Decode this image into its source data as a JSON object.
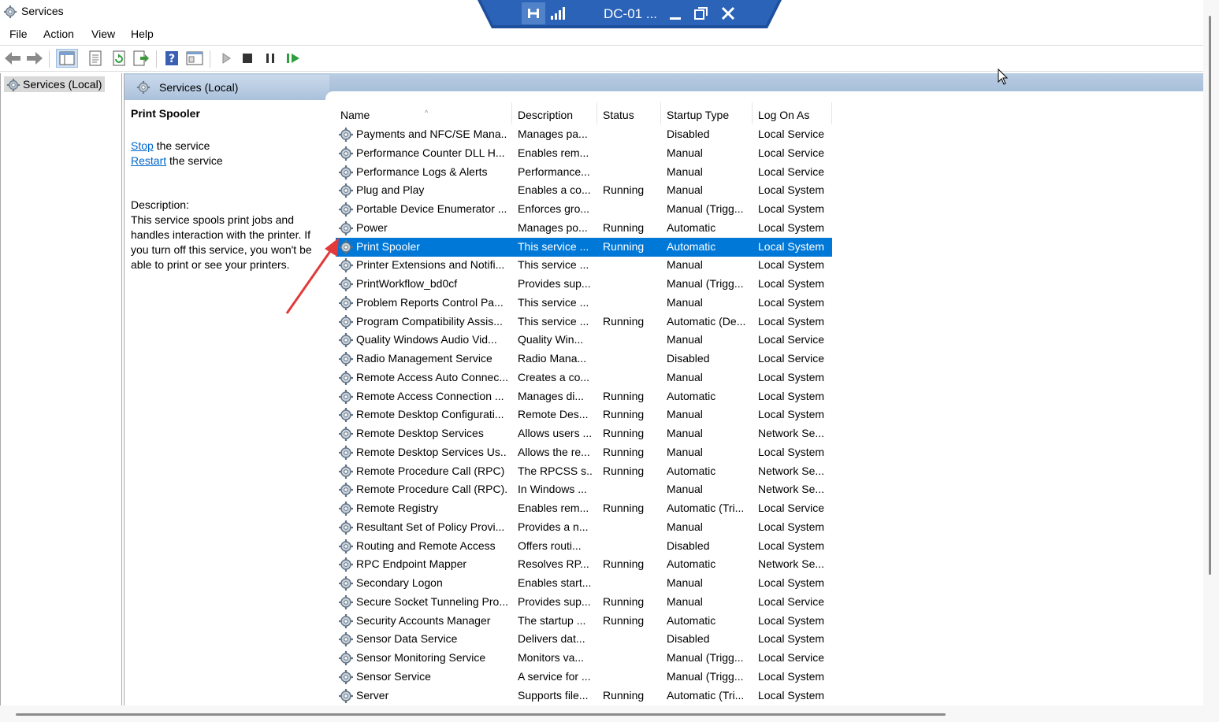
{
  "window": {
    "title": "Services"
  },
  "rdp": {
    "host": "DC-01 ..."
  },
  "menu": [
    "File",
    "Action",
    "View",
    "Help"
  ],
  "toolbar": [
    "back-icon",
    "forward-icon",
    "show-hide-console-tree-icon",
    "properties-icon",
    "refresh-icon",
    "export-list-icon",
    "help-icon",
    "console-view-icon",
    "start-service-icon",
    "stop-service-icon",
    "pause-service-icon",
    "resume-service-icon"
  ],
  "tree": {
    "root": "Services (Local)"
  },
  "pane": {
    "title": "Services (Local)"
  },
  "detail": {
    "service_name": "Print Spooler",
    "stop_link": "Stop",
    "stop_suffix": " the service",
    "restart_link": "Restart",
    "restart_suffix": " the service",
    "description_label": "Description:",
    "description": "This service spools print jobs and handles interaction with the printer. If you turn off this service, you won't be able to print or see your printers."
  },
  "columns": {
    "name": "Name",
    "description": "Description",
    "status": "Status",
    "startup": "Startup Type",
    "logon": "Log On As"
  },
  "services": [
    {
      "name": "Payments and NFC/SE Mana...",
      "desc": "Manages pa...",
      "status": "",
      "startup": "Disabled",
      "logon": "Local Service"
    },
    {
      "name": "Performance Counter DLL H...",
      "desc": "Enables rem...",
      "status": "",
      "startup": "Manual",
      "logon": "Local Service"
    },
    {
      "name": "Performance Logs & Alerts",
      "desc": "Performance...",
      "status": "",
      "startup": "Manual",
      "logon": "Local Service"
    },
    {
      "name": "Plug and Play",
      "desc": "Enables a co...",
      "status": "Running",
      "startup": "Manual",
      "logon": "Local System"
    },
    {
      "name": "Portable Device Enumerator ...",
      "desc": "Enforces gro...",
      "status": "",
      "startup": "Manual (Trigg...",
      "logon": "Local System"
    },
    {
      "name": "Power",
      "desc": "Manages po...",
      "status": "Running",
      "startup": "Automatic",
      "logon": "Local System"
    },
    {
      "name": "Print Spooler",
      "desc": "This service ...",
      "status": "Running",
      "startup": "Automatic",
      "logon": "Local System",
      "selected": true
    },
    {
      "name": "Printer Extensions and Notifi...",
      "desc": "This service ...",
      "status": "",
      "startup": "Manual",
      "logon": "Local System"
    },
    {
      "name": "PrintWorkflow_bd0cf",
      "desc": "Provides sup...",
      "status": "",
      "startup": "Manual (Trigg...",
      "logon": "Local System"
    },
    {
      "name": "Problem Reports Control Pa...",
      "desc": "This service ...",
      "status": "",
      "startup": "Manual",
      "logon": "Local System"
    },
    {
      "name": "Program Compatibility Assis...",
      "desc": "This service ...",
      "status": "Running",
      "startup": "Automatic (De...",
      "logon": "Local System"
    },
    {
      "name": "Quality Windows Audio Vid...",
      "desc": "Quality Win...",
      "status": "",
      "startup": "Manual",
      "logon": "Local Service"
    },
    {
      "name": "Radio Management Service",
      "desc": "Radio Mana...",
      "status": "",
      "startup": "Disabled",
      "logon": "Local Service"
    },
    {
      "name": "Remote Access Auto Connec...",
      "desc": "Creates a co...",
      "status": "",
      "startup": "Manual",
      "logon": "Local System"
    },
    {
      "name": "Remote Access Connection ...",
      "desc": "Manages di...",
      "status": "Running",
      "startup": "Automatic",
      "logon": "Local System"
    },
    {
      "name": "Remote Desktop Configurati...",
      "desc": "Remote Des...",
      "status": "Running",
      "startup": "Manual",
      "logon": "Local System"
    },
    {
      "name": "Remote Desktop Services",
      "desc": "Allows users ...",
      "status": "Running",
      "startup": "Manual",
      "logon": "Network Se..."
    },
    {
      "name": "Remote Desktop Services Us...",
      "desc": "Allows the re...",
      "status": "Running",
      "startup": "Manual",
      "logon": "Local System"
    },
    {
      "name": "Remote Procedure Call (RPC)",
      "desc": "The RPCSS s...",
      "status": "Running",
      "startup": "Automatic",
      "logon": "Network Se..."
    },
    {
      "name": "Remote Procedure Call (RPC)...",
      "desc": "In Windows ...",
      "status": "",
      "startup": "Manual",
      "logon": "Network Se..."
    },
    {
      "name": "Remote Registry",
      "desc": "Enables rem...",
      "status": "Running",
      "startup": "Automatic (Tri...",
      "logon": "Local Service"
    },
    {
      "name": "Resultant Set of Policy Provi...",
      "desc": "Provides a n...",
      "status": "",
      "startup": "Manual",
      "logon": "Local System"
    },
    {
      "name": "Routing and Remote Access",
      "desc": "Offers routi...",
      "status": "",
      "startup": "Disabled",
      "logon": "Local System"
    },
    {
      "name": "RPC Endpoint Mapper",
      "desc": "Resolves RP...",
      "status": "Running",
      "startup": "Automatic",
      "logon": "Network Se..."
    },
    {
      "name": "Secondary Logon",
      "desc": "Enables start...",
      "status": "",
      "startup": "Manual",
      "logon": "Local System"
    },
    {
      "name": "Secure Socket Tunneling Pro...",
      "desc": "Provides sup...",
      "status": "Running",
      "startup": "Manual",
      "logon": "Local Service"
    },
    {
      "name": "Security Accounts Manager",
      "desc": "The startup ...",
      "status": "Running",
      "startup": "Automatic",
      "logon": "Local System"
    },
    {
      "name": "Sensor Data Service",
      "desc": "Delivers dat...",
      "status": "",
      "startup": "Disabled",
      "logon": "Local System"
    },
    {
      "name": "Sensor Monitoring Service",
      "desc": "Monitors va...",
      "status": "",
      "startup": "Manual (Trigg...",
      "logon": "Local Service"
    },
    {
      "name": "Sensor Service",
      "desc": "A service for ...",
      "status": "",
      "startup": "Manual (Trigg...",
      "logon": "Local System"
    },
    {
      "name": "Server",
      "desc": "Supports file...",
      "status": "Running",
      "startup": "Automatic (Tri...",
      "logon": "Local System"
    }
  ],
  "colors": {
    "selection": "#0078d7",
    "link": "#0066cc",
    "rdp_bar": "#1d4f9c",
    "annotation_arrow": "#e23a3a"
  }
}
